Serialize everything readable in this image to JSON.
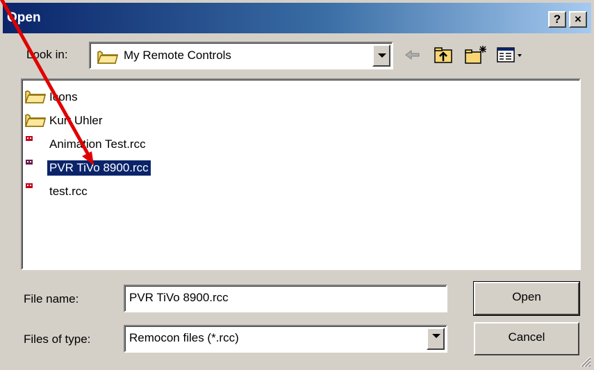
{
  "window": {
    "title": "Open",
    "help_label": "?",
    "close_label": "×"
  },
  "lookin": {
    "label": "Look in:",
    "value": "My Remote Controls",
    "icons": [
      "folder-icon",
      "back-arrow-icon",
      "up-folder-icon",
      "new-folder-icon",
      "view-menu-icon"
    ]
  },
  "files": [
    {
      "name": "Icons",
      "type": "folder",
      "selected": false
    },
    {
      "name": "Kurt Uhler",
      "type": "folder",
      "selected": false
    },
    {
      "name": "Animation Test.rcc",
      "type": "rcc-file",
      "selected": false
    },
    {
      "name": "PVR TiVo 8900.rcc",
      "type": "rcc-file",
      "selected": true
    },
    {
      "name": "test.rcc",
      "type": "rcc-file",
      "selected": false
    }
  ],
  "filename": {
    "label": "File name:",
    "value": "PVR TiVo 8900.rcc"
  },
  "filetype": {
    "label": "Files of type:",
    "value": "Remocon files (*.rcc)"
  },
  "buttons": {
    "open": "Open",
    "cancel": "Cancel"
  },
  "colors": {
    "title_start": "#0a246a",
    "title_end": "#a6caf0",
    "selection": "#0a246a",
    "annotation_arrow": "#e00000"
  }
}
